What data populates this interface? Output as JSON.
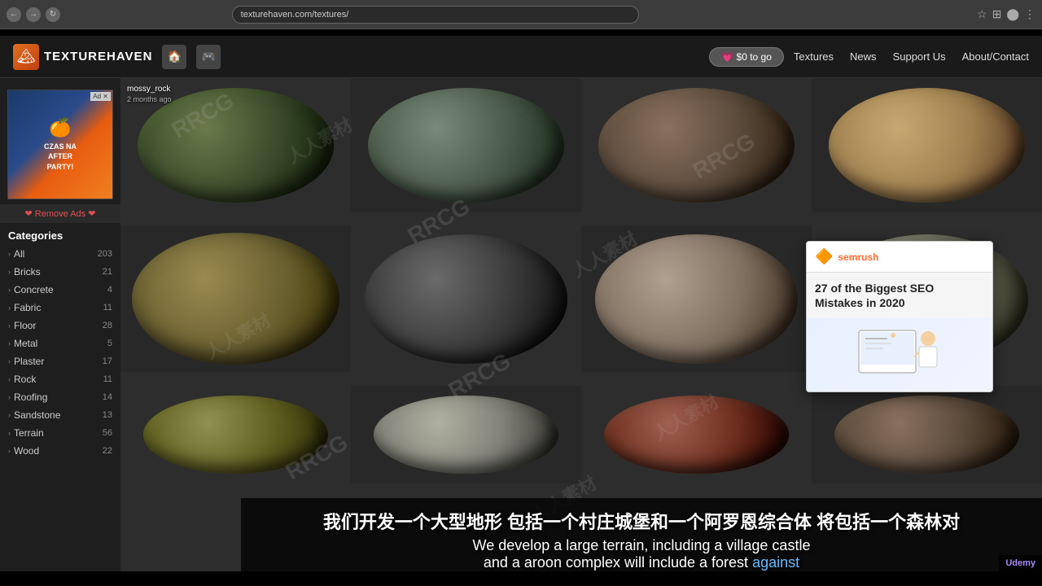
{
  "browser": {
    "back_label": "←",
    "forward_label": "→",
    "refresh_label": "↻",
    "url": "texturehaven.com/textures/",
    "star_icon": "☆",
    "profile_icon": "👤"
  },
  "header": {
    "logo_icon": "🏔",
    "logo_text": "TEXTUREHAVEN",
    "icon1": "🏠",
    "icon2": "🎮",
    "support_label": "💗 $0 to go",
    "nav": {
      "textures": "Textures",
      "news": "News",
      "support_us": "Support Us",
      "about": "About/Contact"
    }
  },
  "sidebar": {
    "categories_title": "Categories",
    "remove_ads": "❤ Remove Ads ❤",
    "items": [
      {
        "name": "All",
        "count": "203"
      },
      {
        "name": "Bricks",
        "count": "21"
      },
      {
        "name": "Concrete",
        "count": "4"
      },
      {
        "name": "Fabric",
        "count": "11"
      },
      {
        "name": "Floor",
        "count": "28"
      },
      {
        "name": "Metal",
        "count": "5"
      },
      {
        "name": "Plaster",
        "count": "17"
      },
      {
        "name": "Rock",
        "count": "11"
      },
      {
        "name": "Roofing",
        "count": "14"
      },
      {
        "name": "Sandstone",
        "count": "13"
      },
      {
        "name": "Terrain",
        "count": "56"
      },
      {
        "name": "Wood",
        "count": "22"
      }
    ],
    "ad_text": "CZAS NA\nAFTER\nPARTY!"
  },
  "textures": [
    {
      "name": "mossy_rock",
      "time": "2 months ago",
      "class": "sphere-mossy-rock"
    },
    {
      "name": "",
      "time": "",
      "class": "sphere-rock-cliff"
    },
    {
      "name": "",
      "time": "",
      "class": "sphere-rock2"
    },
    {
      "name": "",
      "time": "",
      "class": "sphere-wood"
    },
    {
      "name": "",
      "time": "",
      "class": "sphere-boulder-mossy"
    },
    {
      "name": "",
      "time": "",
      "class": "sphere-rock-dark"
    },
    {
      "name": "",
      "time": "",
      "class": "sphere-rock-rough"
    },
    {
      "name": "",
      "time": "",
      "class": "sphere-rock3"
    },
    {
      "name": "",
      "time": "",
      "class": "sphere-moss-ground"
    },
    {
      "name": "",
      "time": "",
      "class": "sphere-concrete"
    },
    {
      "name": "",
      "time": "",
      "class": "sphere-brown"
    },
    {
      "name": "",
      "time": "",
      "class": "sphere-rock2"
    }
  ],
  "ad_popup": {
    "logo": "semrush",
    "title": "27 of the Biggest SEO\nMistakes in 2020"
  },
  "subtitle": {
    "zh": "我们开发一个大型地形 包括一个村庄城堡和一个阿罗恩综合体 将包括一个森林对",
    "en_part1": "We develop a large terrain, including a village castle",
    "en_part2": "and a aroon complex will include a forest against",
    "highlight": "against"
  },
  "watermarks": [
    "RRCG",
    "人人素材"
  ]
}
